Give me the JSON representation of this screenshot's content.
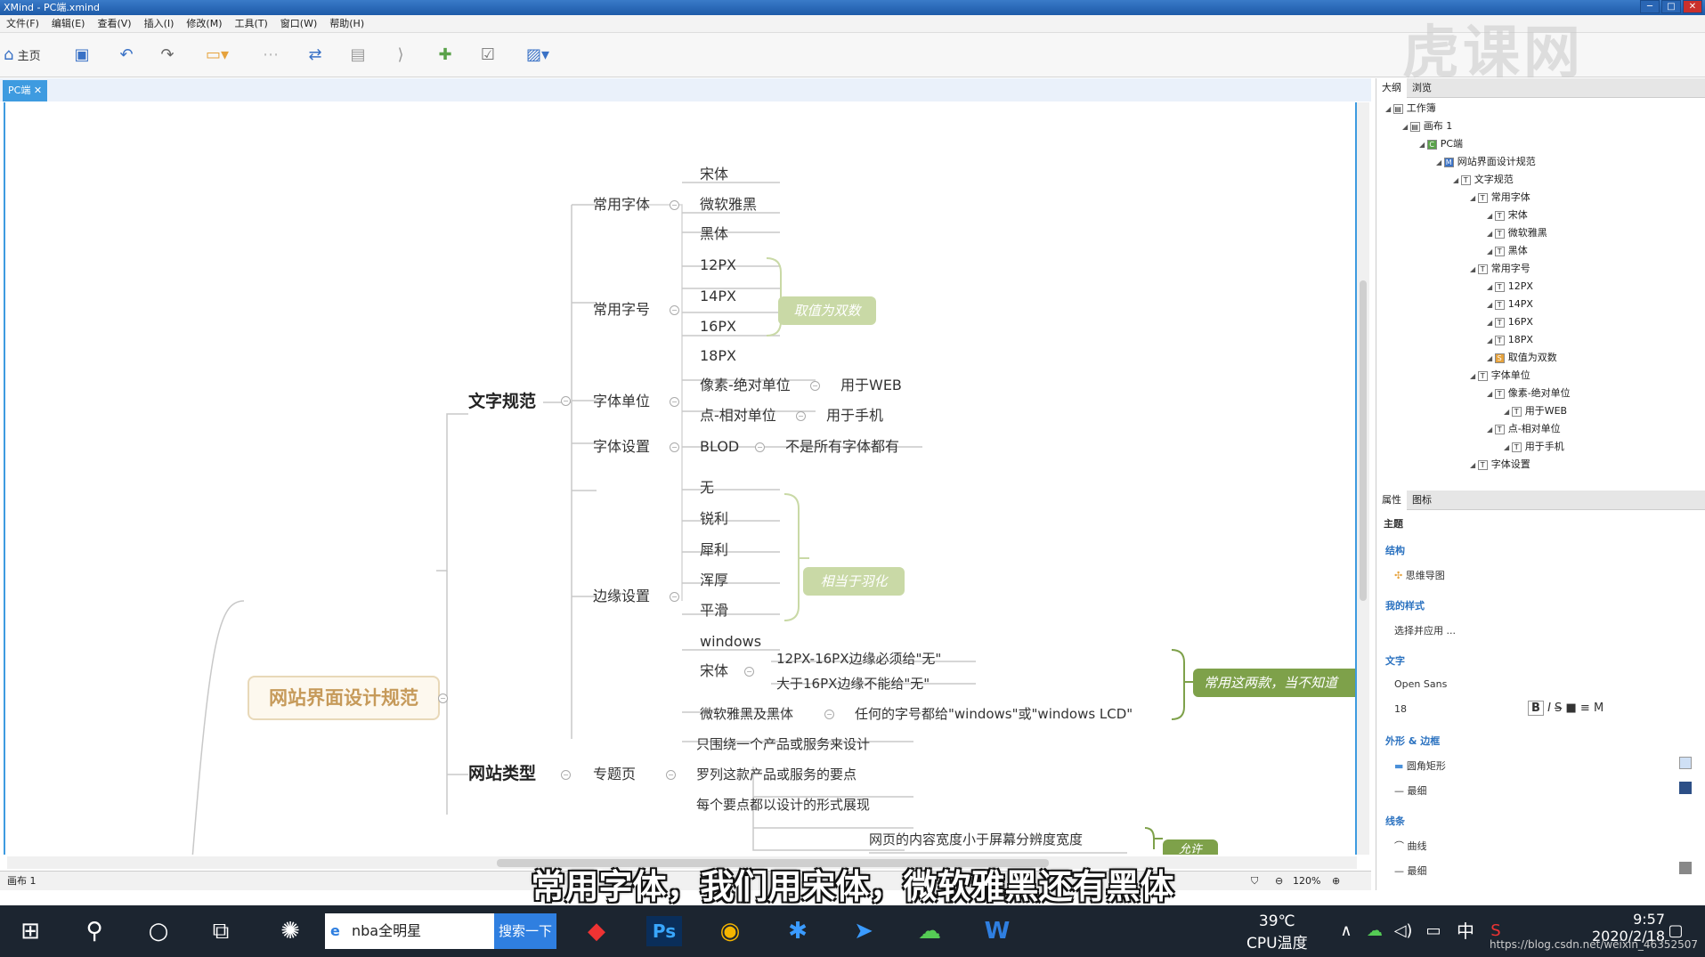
{
  "window": {
    "title": "XMind - PC端.xmind"
  },
  "menu": [
    "文件(F)",
    "编辑(E)",
    "查看(V)",
    "插入(I)",
    "修改(M)",
    "工具(T)",
    "窗口(W)",
    "帮助(H)"
  ],
  "toolbar": {
    "home_label": "主页"
  },
  "tab": {
    "label": "PC端",
    "close": "✕"
  },
  "mindmap": {
    "root": "网站界面设计规范",
    "branch_text": "文字规范",
    "branch_type": "网站类型",
    "common_font": "常用字体",
    "fonts": [
      "宋体",
      "微软雅黑",
      "黑体"
    ],
    "common_size": "常用字号",
    "sizes": [
      "12PX",
      "14PX",
      "16PX",
      "18PX"
    ],
    "size_summary": "取值为双数",
    "font_unit": "字体单位",
    "unit_px": "像素-绝对单位",
    "unit_px_use": "用于WEB",
    "unit_pt": "点-相对单位",
    "unit_pt_use": "用于手机",
    "font_setting": "字体设置",
    "blod": "BLOD",
    "blod_note": "不是所有字体都有",
    "edge_setting": "边缘设置",
    "edges": [
      "无",
      "锐利",
      "犀利",
      "浑厚",
      "平滑",
      "windows"
    ],
    "edge_summary": "相当于羽化",
    "songti": "宋体",
    "songti_rule1": "12PX-16PX边缘必须给\"无\"",
    "songti_rule2": "大于16PX边缘不能给\"无\"",
    "yahei_hei": "微软雅黑及黑体",
    "yahei_rule": "任何的字号都给\"windows\"或\"windows LCD\"",
    "rules_summary": "常用这两款，当不知道",
    "topic_page": "专题页",
    "topic_items": [
      "只围绕一个产品或服务来设计",
      "罗列这款产品或服务的要点",
      "每个要点都以设计的形式展现"
    ],
    "width_note": "网页的内容宽度小于屏幕分辨度宽度",
    "width_summary": "允许"
  },
  "status": {
    "sheet": "画布 1",
    "zoom": "120%"
  },
  "outline": {
    "tabs": [
      "大纲",
      "浏览"
    ],
    "rows": [
      {
        "label": "工作簿",
        "icon": "▤",
        "level": 0
      },
      {
        "label": "画布 1",
        "icon": "▤",
        "level": 1
      },
      {
        "label": "PC端",
        "icon": "C",
        "level": 2
      },
      {
        "label": "网站界面设计规范",
        "icon": "M",
        "level": 3
      },
      {
        "label": "文字规范",
        "icon": "T",
        "level": 4
      },
      {
        "label": "常用字体",
        "icon": "T",
        "level": 5
      },
      {
        "label": "宋体",
        "icon": "T",
        "level": 6
      },
      {
        "label": "微软雅黑",
        "icon": "T",
        "level": 6
      },
      {
        "label": "黑体",
        "icon": "T",
        "level": 6
      },
      {
        "label": "常用字号",
        "icon": "T",
        "level": 5
      },
      {
        "label": "12PX",
        "icon": "T",
        "level": 6
      },
      {
        "label": "14PX",
        "icon": "T",
        "level": 6
      },
      {
        "label": "16PX",
        "icon": "T",
        "level": 6
      },
      {
        "label": "18PX",
        "icon": "T",
        "level": 6
      },
      {
        "label": "取值为双数",
        "icon": "S",
        "level": 6
      },
      {
        "label": "字体单位",
        "icon": "T",
        "level": 5
      },
      {
        "label": "像素-绝对单位",
        "icon": "T",
        "level": 6
      },
      {
        "label": "用于WEB",
        "icon": "T",
        "level": 7
      },
      {
        "label": "点-相对单位",
        "icon": "T",
        "level": 6
      },
      {
        "label": "用于手机",
        "icon": "T",
        "level": 7
      },
      {
        "label": "字体设置",
        "icon": "T",
        "level": 5
      }
    ]
  },
  "properties": {
    "tabs": [
      "属性",
      "图标"
    ],
    "section_title": "主题",
    "structure_head": "结构",
    "structure_value": "思维导图",
    "mystyle_head": "我的样式",
    "mystyle_value": "选择并应用 ...",
    "text_head": "文字",
    "font_name": "Open Sans",
    "font_size": "18",
    "shape_head": "外形 & 边框",
    "shape_value": "圆角矩形",
    "border_value": "最细",
    "line_head": "线条",
    "line_value": "曲线",
    "line_width": "最细"
  },
  "subtitle": "常用字体，我们用宋体，微软雅黑还有黑体",
  "taskbar": {
    "search_text": "nba全明星",
    "search_btn": "搜索一下",
    "temp": "39℃",
    "temp_label": "CPU温度",
    "time": "9:57",
    "date": "2020/2/18",
    "url": "https://blog.csdn.net/weixin_46352507",
    "ime": "中"
  },
  "watermark": "虎课网"
}
